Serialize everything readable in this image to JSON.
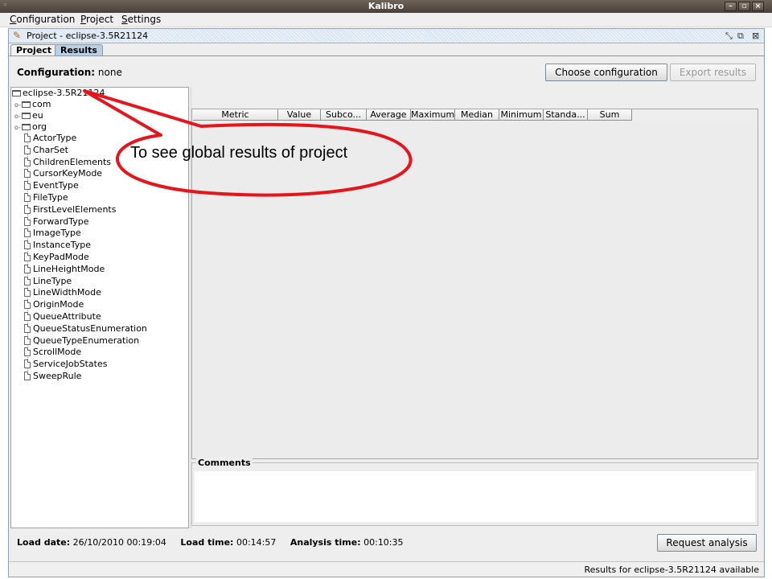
{
  "window": {
    "title": "Kalibro"
  },
  "menu": [
    {
      "mnemonic": "C",
      "rest": "onfiguration"
    },
    {
      "mnemonic": "P",
      "rest": "roject"
    },
    {
      "mnemonic": "S",
      "rest": "ettings"
    }
  ],
  "frame": {
    "title": "Project - eclipse-3.5R21124",
    "tabs": [
      "Project",
      "Results"
    ],
    "active_tab": "Results"
  },
  "config": {
    "label": "Configuration:",
    "value": "none",
    "choose_button": "Choose configuration",
    "export_button": "Export results"
  },
  "tree": {
    "root": "eclipse-3.5R21124",
    "packages": [
      "com",
      "eu",
      "org"
    ],
    "files": [
      "ActorType",
      "CharSet",
      "ChildrenElements",
      "CursorKeyMode",
      "EventType",
      "FileType",
      "FirstLevelElements",
      "ForwardType",
      "ImageType",
      "InstanceType",
      "KeyPadMode",
      "LineHeightMode",
      "LineType",
      "LineWidthMode",
      "OriginMode",
      "QueueAttribute",
      "QueueStatusEnumeration",
      "QueueTypeEnumeration",
      "ScrollMode",
      "ServiceJobStates",
      "SweepRule"
    ]
  },
  "table": {
    "columns": [
      "Metric",
      "Value",
      "Subco...",
      "Average",
      "Maximum",
      "Median",
      "Minimum",
      "Standa...",
      "Sum"
    ]
  },
  "comments": {
    "legend": "Comments"
  },
  "bottom": {
    "load_date_label": "Load date:",
    "load_date": "26/10/2010 00:19:04",
    "load_time_label": "Load time:",
    "load_time": "00:14:57",
    "analysis_time_label": "Analysis time:",
    "analysis_time": "00:10:35",
    "request_button": "Request analysis"
  },
  "status": {
    "text": "Results for eclipse-3.5R21124 available"
  },
  "annotation": {
    "text": "To see global results of project",
    "color": "#e8141c"
  }
}
